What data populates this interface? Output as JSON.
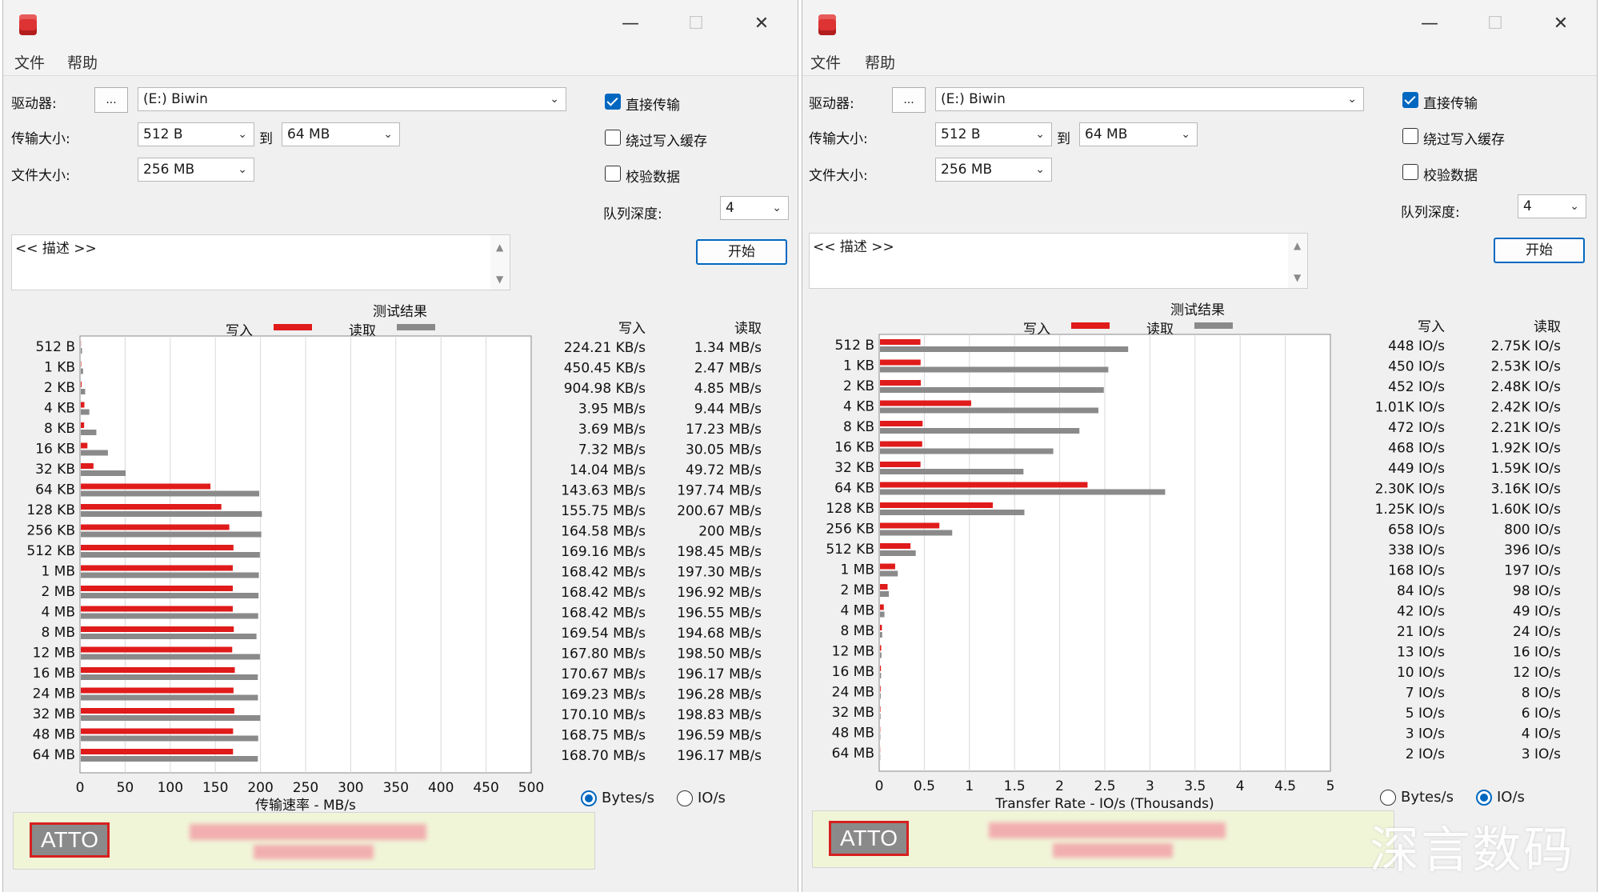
{
  "colors": {
    "write": "#e01b1b",
    "read": "#8a8a8a",
    "accent": "#0067c0",
    "atto_red": "#d62020",
    "atto_bg": "#f0f5d8"
  },
  "windows": [
    {
      "menu": [
        "文件",
        "帮助"
      ],
      "titlebar": {
        "minimize": "—",
        "maximize": "☐",
        "close": "✕"
      },
      "drive_label": "驱动器:",
      "browse_label": "...",
      "drive_value": "(E:) Biwin",
      "transfer_size_label": "传输大小:",
      "transfer_from": "512 B",
      "to_label": "到",
      "transfer_to": "64 MB",
      "file_size_label": "文件大小:",
      "file_size": "256 MB",
      "direct_io": {
        "label": "直接传输",
        "checked": true
      },
      "bypass_cache": {
        "label": "绕过写入缓存",
        "checked": false
      },
      "verify_data": {
        "label": "校验数据",
        "checked": false
      },
      "queue_depth_label": "队列深度:",
      "queue_depth": "4",
      "start_label": "开始",
      "description": "<< 描述 >>",
      "results_title": "测试结果",
      "legend_write": "写入",
      "legend_read": "读取",
      "col_write": "写入",
      "col_read": "读取",
      "unit_bytes": "Bytes/s",
      "unit_io": "IO/s",
      "unit_selected": "bytes",
      "atto_logo": "ATTO",
      "chart_data": {
        "type": "bar",
        "orientation": "horizontal",
        "categories": [
          "512 B",
          "1 KB",
          "2 KB",
          "4 KB",
          "8 KB",
          "16 KB",
          "32 KB",
          "64 KB",
          "128 KB",
          "256 KB",
          "512 KB",
          "1 MB",
          "2 MB",
          "4 MB",
          "8 MB",
          "12 MB",
          "16 MB",
          "24 MB",
          "32 MB",
          "48 MB",
          "64 MB"
        ],
        "series": [
          {
            "name": "写入",
            "values": [
              0.22,
              0.45,
              0.9,
              3.95,
              3.69,
              7.32,
              14.04,
              143.63,
              155.75,
              164.58,
              169.16,
              168.42,
              168.42,
              168.42,
              169.54,
              167.8,
              170.67,
              169.23,
              170.1,
              168.75,
              168.7
            ]
          },
          {
            "name": "读取",
            "values": [
              1.34,
              2.47,
              4.85,
              9.44,
              17.23,
              30.05,
              49.72,
              197.74,
              200.67,
              200,
              198.45,
              197.3,
              196.92,
              196.55,
              194.68,
              198.5,
              196.17,
              196.28,
              198.83,
              196.59,
              196.17
            ]
          }
        ],
        "write_text": [
          "224.21 KB/s",
          "450.45 KB/s",
          "904.98 KB/s",
          "3.95 MB/s",
          "3.69 MB/s",
          "7.32 MB/s",
          "14.04 MB/s",
          "143.63 MB/s",
          "155.75 MB/s",
          "164.58 MB/s",
          "169.16 MB/s",
          "168.42 MB/s",
          "168.42 MB/s",
          "168.42 MB/s",
          "169.54 MB/s",
          "167.80 MB/s",
          "170.67 MB/s",
          "169.23 MB/s",
          "170.10 MB/s",
          "168.75 MB/s",
          "168.70 MB/s"
        ],
        "read_text": [
          "1.34 MB/s",
          "2.47 MB/s",
          "4.85 MB/s",
          "9.44 MB/s",
          "17.23 MB/s",
          "30.05 MB/s",
          "49.72 MB/s",
          "197.74 MB/s",
          "200.67 MB/s",
          "200 MB/s",
          "198.45 MB/s",
          "197.30 MB/s",
          "196.92 MB/s",
          "196.55 MB/s",
          "194.68 MB/s",
          "198.50 MB/s",
          "196.17 MB/s",
          "196.28 MB/s",
          "198.83 MB/s",
          "196.59 MB/s",
          "196.17 MB/s"
        ],
        "xticks": [
          "0",
          "50",
          "100",
          "150",
          "200",
          "250",
          "300",
          "350",
          "400",
          "450",
          "500"
        ],
        "xlim": [
          0,
          500
        ],
        "xlabel": "传输速率 - MB/s",
        "grid": true
      }
    },
    {
      "menu": [
        "文件",
        "帮助"
      ],
      "titlebar": {
        "minimize": "—",
        "maximize": "☐",
        "close": "✕"
      },
      "drive_label": "驱动器:",
      "browse_label": "...",
      "drive_value": "(E:) Biwin",
      "transfer_size_label": "传输大小:",
      "transfer_from": "512 B",
      "to_label": "到",
      "transfer_to": "64 MB",
      "file_size_label": "文件大小:",
      "file_size": "256 MB",
      "direct_io": {
        "label": "直接传输",
        "checked": true
      },
      "bypass_cache": {
        "label": "绕过写入缓存",
        "checked": false
      },
      "verify_data": {
        "label": "校验数据",
        "checked": false
      },
      "queue_depth_label": "队列深度:",
      "queue_depth": "4",
      "start_label": "开始",
      "description": "<< 描述 >>",
      "results_title": "测试结果",
      "legend_write": "写入",
      "legend_read": "读取",
      "col_write": "写入",
      "col_read": "读取",
      "unit_bytes": "Bytes/s",
      "unit_io": "IO/s",
      "unit_selected": "io",
      "atto_logo": "ATTO",
      "chart_data": {
        "type": "bar",
        "orientation": "horizontal",
        "categories": [
          "512 B",
          "1 KB",
          "2 KB",
          "4 KB",
          "8 KB",
          "16 KB",
          "32 KB",
          "64 KB",
          "128 KB",
          "256 KB",
          "512 KB",
          "1 MB",
          "2 MB",
          "4 MB",
          "8 MB",
          "12 MB",
          "16 MB",
          "24 MB",
          "32 MB",
          "48 MB",
          "64 MB"
        ],
        "series": [
          {
            "name": "写入",
            "values": [
              0.448,
              0.45,
              0.452,
              1.01,
              0.472,
              0.468,
              0.449,
              2.3,
              1.25,
              0.658,
              0.338,
              0.168,
              0.084,
              0.042,
              0.021,
              0.013,
              0.01,
              0.007,
              0.005,
              0.003,
              0.002
            ]
          },
          {
            "name": "读取",
            "values": [
              2.75,
              2.53,
              2.48,
              2.42,
              2.21,
              1.92,
              1.59,
              3.16,
              1.6,
              0.8,
              0.396,
              0.197,
              0.098,
              0.049,
              0.024,
              0.016,
              0.012,
              0.008,
              0.006,
              0.004,
              0.003
            ]
          }
        ],
        "write_text": [
          "448 IO/s",
          "450 IO/s",
          "452 IO/s",
          "1.01K IO/s",
          "472 IO/s",
          "468 IO/s",
          "449 IO/s",
          "2.30K IO/s",
          "1.25K IO/s",
          "658 IO/s",
          "338 IO/s",
          "168 IO/s",
          "84 IO/s",
          "42 IO/s",
          "21 IO/s",
          "13 IO/s",
          "10 IO/s",
          "7 IO/s",
          "5 IO/s",
          "3 IO/s",
          "2 IO/s"
        ],
        "read_text": [
          "2.75K IO/s",
          "2.53K IO/s",
          "2.48K IO/s",
          "2.42K IO/s",
          "2.21K IO/s",
          "1.92K IO/s",
          "1.59K IO/s",
          "3.16K IO/s",
          "1.60K IO/s",
          "800 IO/s",
          "396 IO/s",
          "197 IO/s",
          "98 IO/s",
          "49 IO/s",
          "24 IO/s",
          "16 IO/s",
          "12 IO/s",
          "8 IO/s",
          "6 IO/s",
          "4 IO/s",
          "3 IO/s"
        ],
        "xticks": [
          "0",
          "0.5",
          "1",
          "1.5",
          "2",
          "2.5",
          "3",
          "3.5",
          "4",
          "4.5",
          "5"
        ],
        "xlim": [
          0,
          5
        ],
        "xlabel": "Transfer Rate - IO/s (Thousands)",
        "grid": true
      }
    }
  ],
  "watermark": "深言数码"
}
